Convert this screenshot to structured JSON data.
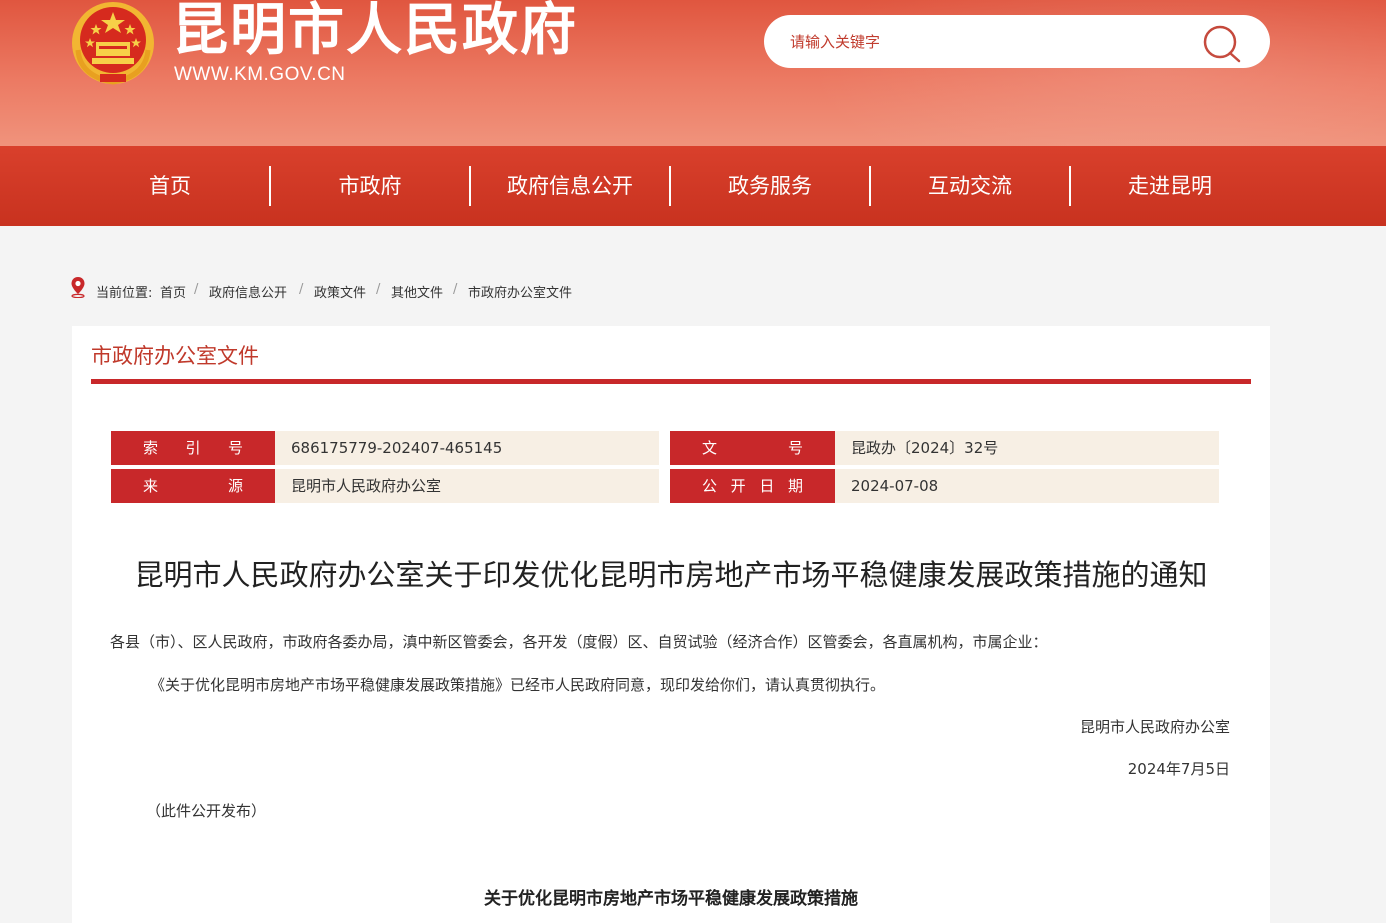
{
  "header": {
    "site_title": "昆明市人民政府",
    "site_url": "WWW.KM.GOV.CN",
    "search_placeholder": "请输入关键字"
  },
  "nav": {
    "items": [
      "首页",
      "市政府",
      "政府信息公开",
      "政务服务",
      "互动交流",
      "走进昆明"
    ]
  },
  "breadcrumb": {
    "label": "当前位置:",
    "items": [
      "首页",
      "政府信息公开",
      "政策文件",
      "其他文件",
      "市政府办公室文件"
    ],
    "separator": "/"
  },
  "panel": {
    "title": "市政府办公室文件"
  },
  "meta": {
    "index_label": [
      "索",
      "引",
      "号"
    ],
    "index_value": "686175779-202407-465145",
    "doc_no_label": [
      "文",
      "号"
    ],
    "doc_no_value": "昆政办〔2024〕32号",
    "source_label": [
      "来",
      "源"
    ],
    "source_value": "昆明市人民政府办公室",
    "date_label": [
      "公",
      "开",
      "日",
      "期"
    ],
    "date_value": "2024-07-08"
  },
  "document": {
    "title": "昆明市人民政府办公室关于印发优化昆明市房地产市场平稳健康发展政策措施的通知",
    "addressee": "各县（市）、区人民政府，市政府各委办局，滇中新区管委会，各开发（度假）区、自贸试验（经济合作）区管委会，各直属机构，市属企业：",
    "body": "《关于优化昆明市房地产市场平稳健康发展政策措施》已经市人民政府同意，现印发给你们，请认真贯彻执行。",
    "signature": "昆明市人民政府办公室",
    "date": "2024年7月5日",
    "note": "（此件公开发布）",
    "attachment_title": "关于优化昆明市房地产市场平稳健康发展政策措施"
  },
  "colors": {
    "brand_red": "#c8282a",
    "header_gradient_top": "#e0563f",
    "meta_value_bg": "#f7efe4"
  }
}
